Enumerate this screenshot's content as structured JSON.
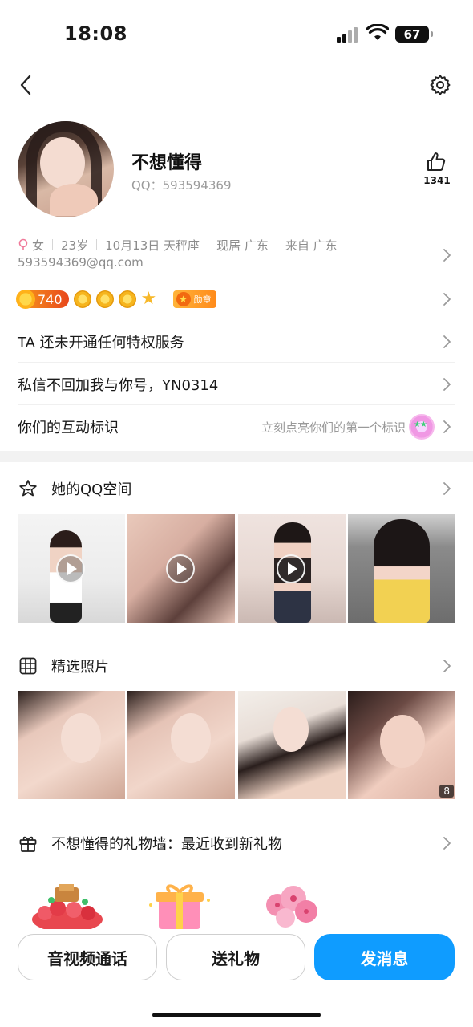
{
  "status_bar": {
    "time": "18:08",
    "battery": "67"
  },
  "profile": {
    "nickname": "不想懂得",
    "qq_label": "QQ：593594369",
    "likes": "1341"
  },
  "info": {
    "gender": "女",
    "age": "23岁",
    "birthday": "10月13日 天秤座",
    "residence": "现居 广东",
    "hometown": "来自 广东",
    "email": "593594369@qq.com"
  },
  "badges": {
    "level": "740",
    "medal_label": "勋章"
  },
  "rows": {
    "privilege": "TA 还未开通任何特权服务",
    "signature": "私信不回加我与你号，YN0314",
    "interaction_title": "你们的互动标识",
    "interaction_hint": "立刻点亮你们的第一个标识"
  },
  "sections": {
    "qzone_title": "她的QQ空间",
    "featured_title": "精选照片",
    "featured_count": "8",
    "gift_title": "不想懂得的礼物墙：最近收到新礼物"
  },
  "actions": {
    "call": "音视频通话",
    "gift": "送礼物",
    "message": "发消息"
  },
  "colors": {
    "primary": "#0f9cff",
    "divider": "#f2f2f2",
    "secondary_text": "#8c8c8c"
  }
}
